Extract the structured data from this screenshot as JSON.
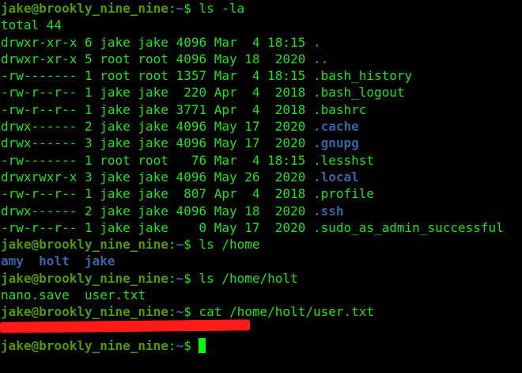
{
  "prompt": {
    "user_host": "jake@brookly_nine_nine",
    "colon": ":",
    "path": "~",
    "symbol": "$ "
  },
  "commands": [
    "ls -la",
    "ls /home",
    "ls /home/holt",
    "cat /home/holt/user.txt"
  ],
  "total": "total 44",
  "listing": [
    {
      "meta": "drwxr-xr-x 6 jake jake 4096 Mar  4 18:15 ",
      "name": ".",
      "dir": true
    },
    {
      "meta": "drwxr-xr-x 5 root root 4096 May 18  2020 ",
      "name": "..",
      "dir": true
    },
    {
      "meta": "-rw------- 1 root root 1357 Mar  4 18:15 ",
      "name": ".bash_history",
      "dir": false
    },
    {
      "meta": "-rw-r--r-- 1 jake jake  220 Apr  4  2018 ",
      "name": ".bash_logout",
      "dir": false
    },
    {
      "meta": "-rw-r--r-- 1 jake jake 3771 Apr  4  2018 ",
      "name": ".bashrc",
      "dir": false
    },
    {
      "meta": "drwx------ 2 jake jake 4096 May 17  2020 ",
      "name": ".cache",
      "dir": true
    },
    {
      "meta": "drwx------ 3 jake jake 4096 May 17  2020 ",
      "name": ".gnupg",
      "dir": true
    },
    {
      "meta": "-rw------- 1 root root   76 Mar  4 18:15 ",
      "name": ".lesshst",
      "dir": false
    },
    {
      "meta": "drwxrwxr-x 3 jake jake 4096 May 26  2020 ",
      "name": ".local",
      "dir": true
    },
    {
      "meta": "-rw-r--r-- 1 jake jake  807 Apr  4  2018 ",
      "name": ".profile",
      "dir": false
    },
    {
      "meta": "drwx------ 2 jake jake 4096 May 18  2020 ",
      "name": ".ssh",
      "dir": true
    },
    {
      "meta": "-rw-r--r-- 1 jake jake    0 May 17  2020 ",
      "name": ".sudo_as_admin_successful",
      "dir": false
    }
  ],
  "home_dirs": [
    "amy",
    "holt",
    "jake"
  ],
  "holt_files": [
    "nano.save",
    "user.txt"
  ],
  "colors": {
    "prompt_user": "#4e9a06",
    "prompt_path": "#3465a4",
    "text": "#1ee01e",
    "redaction": "#ff1a1a",
    "cursor": "#00ff00"
  }
}
